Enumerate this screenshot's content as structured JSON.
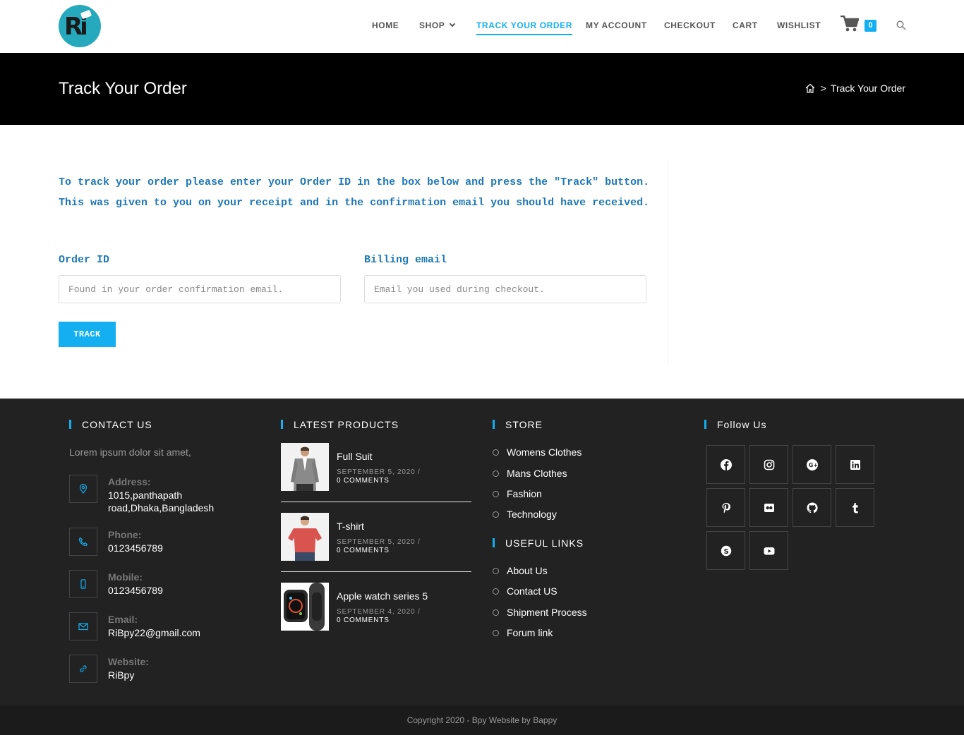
{
  "nav": {
    "items": [
      "HOME",
      "SHOP",
      "TRACK YOUR ORDER",
      "MY ACCOUNT",
      "CHECKOUT",
      "CART",
      "WISHLIST"
    ],
    "cart_count": "0"
  },
  "titlebar": {
    "title": "Track Your Order",
    "breadcrumb_sep": ">",
    "breadcrumb_current": "Track Your Order"
  },
  "form": {
    "intro": "To track your order please enter your Order ID in the box below and press the \"Track\" button. This was given to you on your receipt and in the confirmation email you should have received.",
    "order_label": "Order ID",
    "order_placeholder": "Found in your order confirmation email.",
    "email_label": "Billing email",
    "email_placeholder": "Email you used during checkout.",
    "button": "TRACK"
  },
  "footer": {
    "contact": {
      "heading": "CONTACT US",
      "lorem": "Lorem ipsum dolor sit amet,",
      "address_label": "Address:",
      "address": "1015,panthapath road,Dhaka,Bangladesh",
      "phone_label": "Phone:",
      "phone": "0123456789",
      "mobile_label": "Mobile:",
      "mobile": "0123456789",
      "email_label": "Email:",
      "email": "RiBpy22@gmail.com",
      "website_label": "Website:",
      "website": "RiBpy"
    },
    "products": {
      "heading": "LATEST PRODUCTS",
      "items": [
        {
          "name": "Full Suit",
          "date": "SEPTEMBER 5, 2020 /",
          "comments": "0 COMMENTS"
        },
        {
          "name": "T-shirt",
          "date": "SEPTEMBER 5, 2020 /",
          "comments": "0 COMMENTS"
        },
        {
          "name": "Apple watch series 5",
          "date": "SEPTEMBER 4, 2020 /",
          "comments": "0 COMMENTS"
        }
      ]
    },
    "store": {
      "heading": "STORE",
      "links": [
        "Womens Clothes",
        "Mans Clothes",
        "Fashion",
        "Technology"
      ]
    },
    "useful": {
      "heading": "USEFUL LINKS",
      "links": [
        "About Us",
        "Contact US",
        "Shipment Process",
        "Forum link"
      ]
    },
    "follow": {
      "heading": "Follow Us",
      "icons": [
        "facebook-icon",
        "instagram-icon",
        "google-plus-icon",
        "linkedin-icon",
        "pinterest-icon",
        "flickr-icon",
        "github-icon",
        "tumblr-icon",
        "skype-icon",
        "youtube-icon"
      ]
    },
    "copyright": "Copyright 2020 - Bpy Website by Bappy"
  },
  "colors": {
    "accent": "#13aff0",
    "intro_text": "#1f78b4",
    "titlebar_bg": "#000000",
    "footer_bg": "#222222"
  }
}
